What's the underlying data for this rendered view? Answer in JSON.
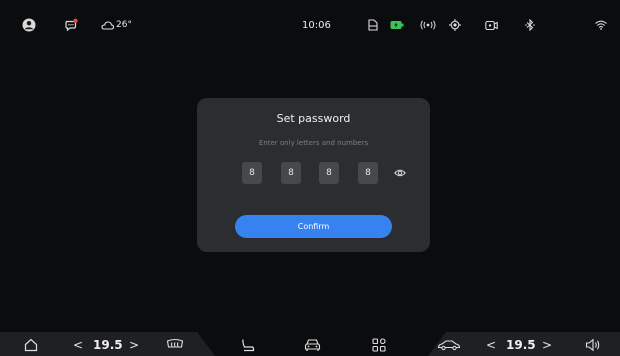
{
  "status_bar": {
    "weather": "26°",
    "time": "10:06"
  },
  "dialog": {
    "title": "Set password",
    "hint": "Enter only letters and numbers",
    "pin": [
      "8",
      "8",
      "8",
      "8"
    ],
    "confirm_label": "Confirm"
  },
  "dock": {
    "left_temp": "19.5",
    "right_temp": "19.5",
    "arrow_left": "<",
    "arrow_right": ">"
  },
  "colors": {
    "accent": "#3582f0",
    "notification_dot": "#e04a4a",
    "battery": "#3ec35a"
  }
}
